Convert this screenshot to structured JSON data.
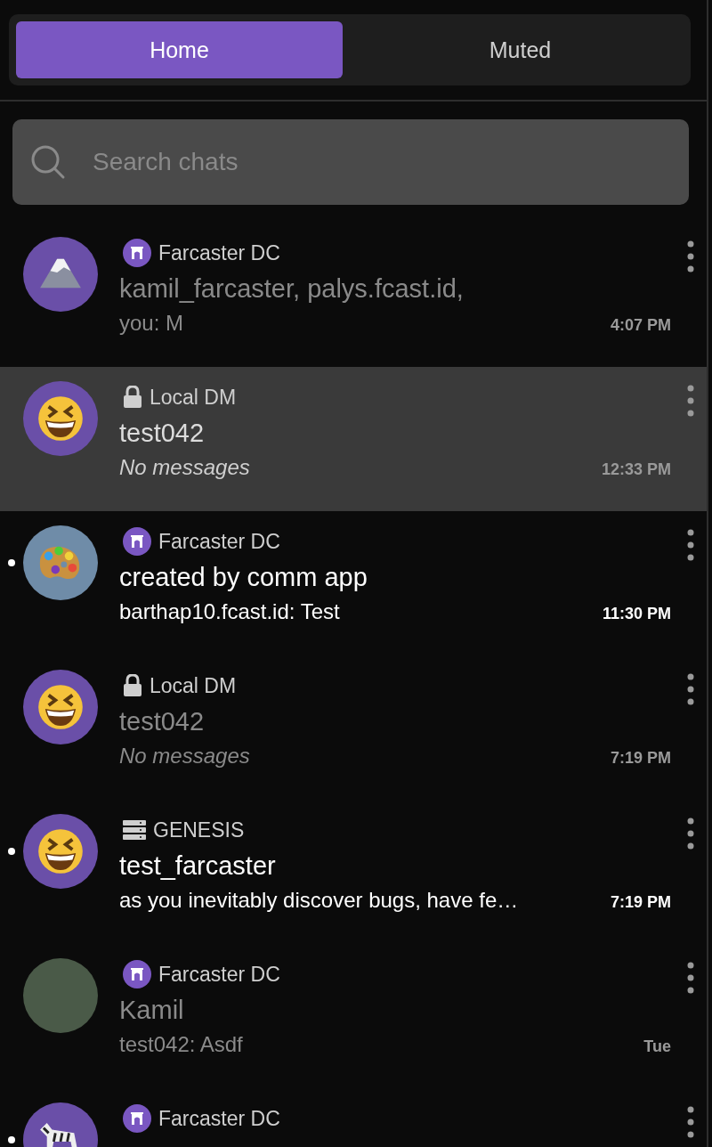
{
  "tabs": [
    {
      "label": "Home",
      "selected": true
    },
    {
      "label": "Muted",
      "selected": false
    }
  ],
  "search": {
    "placeholder": "Search chats"
  },
  "chats": [
    {
      "avatar": {
        "kind": "mountain",
        "color": "#6a4fa8"
      },
      "community": {
        "kind": "farcaster",
        "name": "Farcaster DC"
      },
      "title": "kamil_farcaster, palys.fcast.id,",
      "preview": {
        "kind": "message",
        "text": "you: M"
      },
      "time": "4:07 PM",
      "unread": false,
      "selected": false
    },
    {
      "avatar": {
        "kind": "grin",
        "color": "#6a4fa8"
      },
      "community": {
        "kind": "lock",
        "name": "Local DM"
      },
      "title": "test042",
      "preview": {
        "kind": "empty",
        "text": "No messages"
      },
      "time": "12:33 PM",
      "unread": false,
      "selected": true
    },
    {
      "avatar": {
        "kind": "palette",
        "color": "#6f8ca8"
      },
      "community": {
        "kind": "farcaster",
        "name": "Farcaster DC"
      },
      "title": "created by comm app",
      "preview": {
        "kind": "message",
        "text": "barthap10.fcast.id: Test"
      },
      "time": "11:30 PM",
      "unread": true,
      "selected": false
    },
    {
      "avatar": {
        "kind": "grin",
        "color": "#6a4fa8"
      },
      "community": {
        "kind": "lock",
        "name": "Local DM"
      },
      "title": "test042",
      "preview": {
        "kind": "empty",
        "text": "No messages"
      },
      "time": "7:19 PM",
      "unread": false,
      "selected": false
    },
    {
      "avatar": {
        "kind": "grin",
        "color": "#6a4fa8"
      },
      "community": {
        "kind": "server",
        "name": "GENESIS"
      },
      "title": "test_farcaster",
      "preview": {
        "kind": "message",
        "text": "as you inevitably discover bugs, have fe…"
      },
      "time": "7:19 PM",
      "unread": true,
      "selected": false
    },
    {
      "avatar": {
        "kind": "photo",
        "color": "#4a5a48"
      },
      "community": {
        "kind": "farcaster",
        "name": "Farcaster DC"
      },
      "title": "Kamil",
      "preview": {
        "kind": "message",
        "text": "test042: Asdf"
      },
      "time": "Tue",
      "unread": false,
      "selected": false
    },
    {
      "avatar": {
        "kind": "zebra",
        "color": "#6a4fa8"
      },
      "community": {
        "kind": "farcaster",
        "name": "Farcaster DC"
      },
      "unread": true,
      "selected": false
    }
  ]
}
